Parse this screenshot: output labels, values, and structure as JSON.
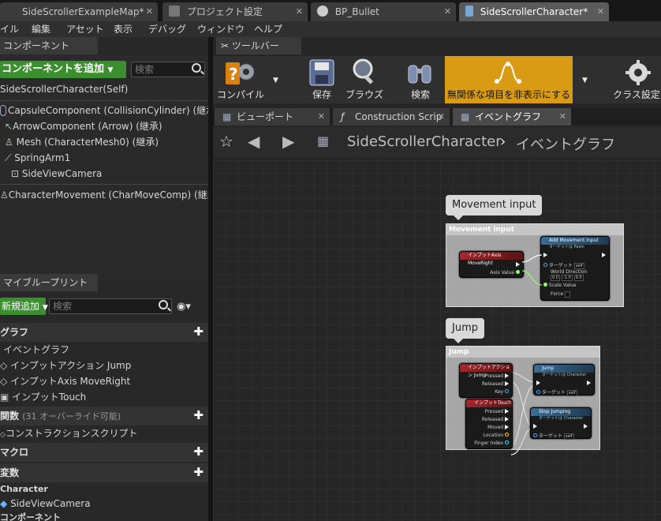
{
  "tabs": [
    {
      "label": "SideScrollerExampleMap*"
    },
    {
      "label": "プロジェクト設定"
    },
    {
      "label": "BP_Bullet"
    },
    {
      "label": "SideScrollerCharacter*"
    }
  ],
  "menu": [
    "イル",
    "編集",
    "アセット",
    "表示",
    "デバッグ",
    "ウィンドウ",
    "ヘルプ"
  ],
  "components": {
    "title": "コンポーネント",
    "add_button": "コンポーネントを追加",
    "search_placeholder": "検索",
    "self": "SideScrollerCharacter(Self)",
    "items": [
      "CapsuleComponent (CollisionCylinder) (継承)",
      "ArrowComponent (Arrow) (継承)",
      "Mesh (CharacterMesh0) (継承)",
      "SpringArm1",
      "SideViewCamera",
      "CharacterMovement (CharMoveComp) (継承)"
    ]
  },
  "myblueprint": {
    "title": "マイブループリント",
    "add_button": "新規追加",
    "search_placeholder": "検索",
    "graph_cat": "グラフ",
    "event_graph": "イベントグラフ",
    "graph_items": [
      "インプットアクション Jump",
      "インプットAxis MoveRight",
      "インプットTouch"
    ],
    "func_cat": "関数",
    "func_note": "(31 オーバーライド可能)",
    "construct": "コンストラクションスクリプト",
    "macro_cat": "マクロ",
    "var_cat": "変数",
    "var_sub": "Character",
    "var_item": "SideViewCamera",
    "comp_cat": "コンポーネント"
  },
  "toolbar": {
    "title": "ツールバー",
    "compile": "コンパイル",
    "save": "保存",
    "browse": "ブラウズ",
    "search": "検索",
    "hide_unrelated": "無関係な項目を非表示にする",
    "class_settings": "クラス設定"
  },
  "editor_tabs": [
    "ビューポート",
    "Construction Scrip",
    "イベントグラフ"
  ],
  "breadcrumb": {
    "blueprint": "SideScrollerCharacter",
    "graph": "イベントグラフ"
  },
  "graph": {
    "comment1": {
      "bubble": "Movement input",
      "header": "Movement input"
    },
    "comment2": {
      "bubble": "Jump",
      "header": "Jump"
    },
    "axis_node": {
      "title": "インプットAxis MoveRight",
      "pin": "Axis Value"
    },
    "add_move_node": {
      "title": "Add Movement Input",
      "sub": "ターゲットは Pawn",
      "target": "ターゲット",
      "self": "self",
      "world_dir": "World Direction",
      "x": "0.0",
      "y": "-1.0",
      "z": "0.0",
      "scale": "Scale Value",
      "force": "Force"
    },
    "jump_action_node": {
      "title": "インプットアクション Jump",
      "pressed": "Pressed",
      "released": "Released",
      "key": "Key"
    },
    "touch_node": {
      "title": "インプットTouch",
      "pressed": "Pressed",
      "released": "Released",
      "moved": "Moved",
      "location": "Location",
      "finger": "Finger Index"
    },
    "jump_node": {
      "title": "Jump",
      "sub": "ターゲットは Character",
      "target": "ターゲット",
      "self": "self"
    },
    "stop_jump_node": {
      "title": "Stop Jumping",
      "sub": "ターゲットは Character",
      "target": "ターゲット",
      "self": "self"
    }
  },
  "colors": {
    "accent_green": "#3b8f2e",
    "highlight": "#d99b14",
    "node_red": "#a8262b",
    "node_blue": "#3b6d96"
  }
}
